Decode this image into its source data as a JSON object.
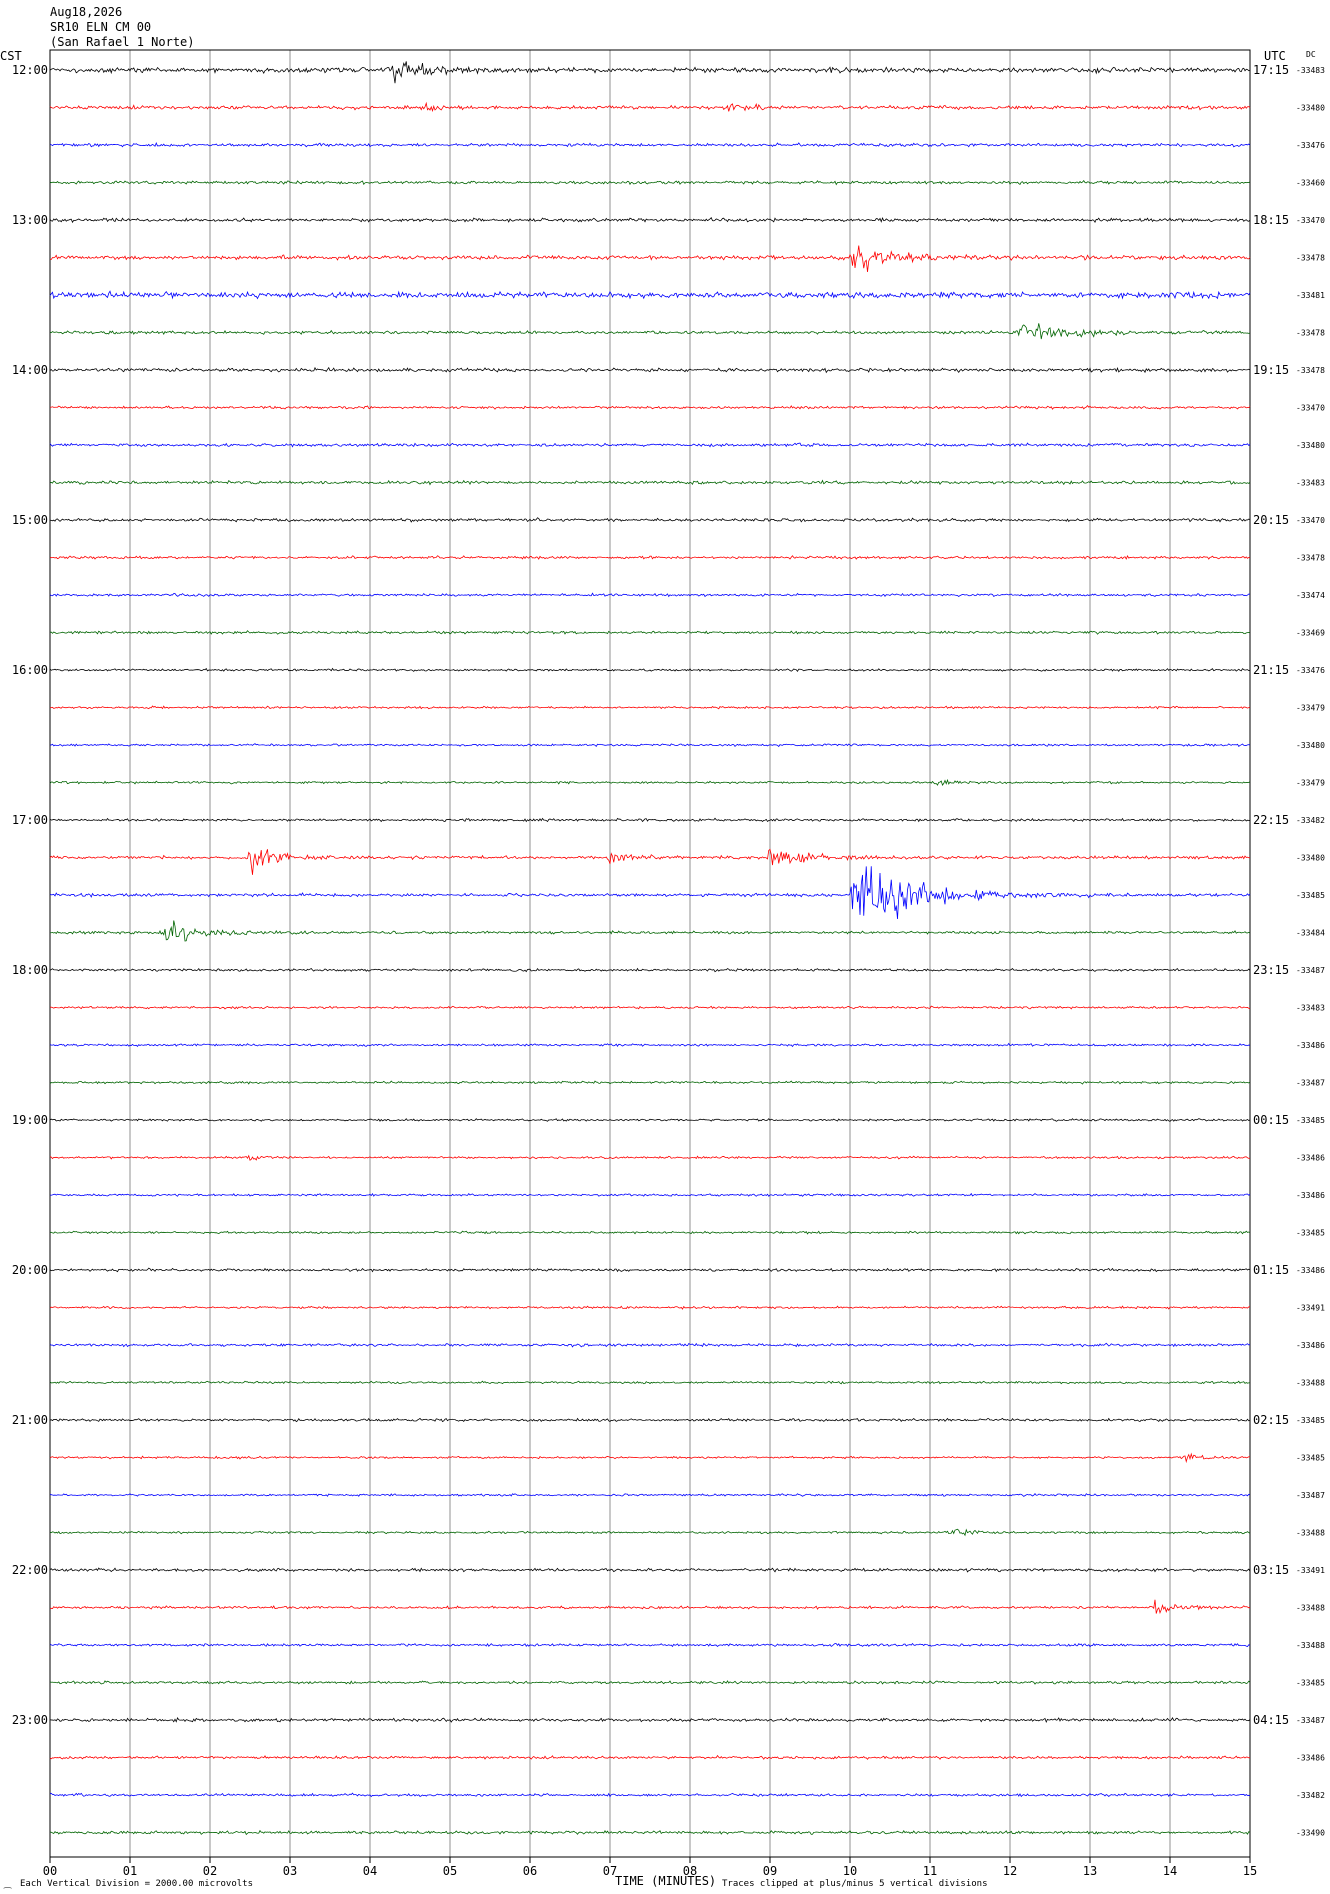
{
  "header": {
    "date": "Aug18,2026",
    "station": "SR10 ELN CM 00",
    "location": "(San Rafael 1 Norte)",
    "left_tz": "CST",
    "right_tz": "UTC",
    "dc_label": "DC"
  },
  "footer": {
    "scale_note": "Each Vertical Division = 2000.00 microvolts",
    "clip_note": "Traces clipped at plus/minus 5 vertical divisions"
  },
  "colors": {
    "black": "#000000",
    "red": "#ff0000",
    "blue": "#0000ff",
    "green": "#006400",
    "grid": "#909090"
  },
  "chart_data": {
    "type": "line",
    "title": "",
    "xlabel": "TIME (MINUTES)",
    "xlim": [
      0,
      15
    ],
    "x_ticks": [
      "00",
      "01",
      "02",
      "03",
      "04",
      "05",
      "06",
      "07",
      "08",
      "09",
      "10",
      "11",
      "12",
      "13",
      "14",
      "15"
    ],
    "trace_color_cycle": [
      "black",
      "red",
      "blue",
      "green"
    ],
    "hour_labels_cst": [
      "12:00",
      "13:00",
      "14:00",
      "15:00",
      "16:00",
      "17:00",
      "18:00",
      "19:00",
      "20:00",
      "21:00",
      "22:00",
      "23:00"
    ],
    "hour_labels_utc": [
      "17:15",
      "18:15",
      "19:15",
      "20:15",
      "21:15",
      "22:15",
      "23:15",
      "00:15",
      "01:15",
      "02:15",
      "03:15",
      "04:15"
    ],
    "dc_offsets": [
      "-33483",
      "-33480",
      "-33476",
      "-33460",
      "-33470",
      "-33478",
      "-33481",
      "-33478",
      "-33478",
      "-33470",
      "-33480",
      "-33483",
      "-33470",
      "-33478",
      "-33474",
      "-33469",
      "-33476",
      "-33479",
      "-33480",
      "-33479",
      "-33482",
      "-33480",
      "-33485",
      "-33484",
      "-33487",
      "-33483",
      "-33486",
      "-33487",
      "-33485",
      "-33486",
      "-33486",
      "-33485",
      "-33486",
      "-33491",
      "-33486",
      "-33488",
      "-33485",
      "-33485",
      "-33487",
      "-33488",
      "-33491",
      "-33488",
      "-33488",
      "-33485",
      "-33487",
      "-33486",
      "-33482",
      "-33490"
    ],
    "noise_amplitude": [
      2.2,
      1.6,
      1.4,
      1.4,
      1.6,
      1.8,
      2.6,
      1.4,
      1.6,
      1.2,
      1.4,
      1.4,
      1.4,
      1.2,
      1.2,
      1.2,
      1.0,
      1.0,
      1.0,
      1.0,
      1.2,
      1.4,
      1.4,
      1.2,
      1.2,
      1.0,
      1.0,
      1.0,
      1.0,
      1.0,
      1.0,
      1.0,
      1.2,
      1.0,
      1.2,
      1.0,
      1.2,
      1.0,
      1.0,
      1.0,
      1.4,
      1.2,
      1.2,
      1.2,
      1.4,
      1.2,
      1.2,
      1.4
    ],
    "events": [
      {
        "trace": 0,
        "minute": 4.25,
        "amplitude": 20,
        "duration": 0.7
      },
      {
        "trace": 1,
        "minute": 4.7,
        "amplitude": 5,
        "duration": 0.3
      },
      {
        "trace": 1,
        "minute": 8.5,
        "amplitude": 4,
        "duration": 0.4
      },
      {
        "trace": 5,
        "minute": 10.05,
        "amplitude": 14,
        "duration": 0.9
      },
      {
        "trace": 7,
        "minute": 12.1,
        "amplitude": 14,
        "duration": 1.1
      },
      {
        "trace": 19,
        "minute": 11.1,
        "amplitude": 5,
        "duration": 0.3
      },
      {
        "trace": 21,
        "minute": 2.5,
        "amplitude": 12,
        "duration": 0.7
      },
      {
        "trace": 21,
        "minute": 7.0,
        "amplitude": 7,
        "duration": 0.4
      },
      {
        "trace": 21,
        "minute": 9.0,
        "amplitude": 11,
        "duration": 0.8
      },
      {
        "trace": 22,
        "minute": 10.05,
        "amplitude": 42,
        "duration": 1.4
      },
      {
        "trace": 23,
        "minute": 1.45,
        "amplitude": 12,
        "duration": 0.9
      },
      {
        "trace": 29,
        "minute": 2.45,
        "amplitude": 4,
        "duration": 0.3
      },
      {
        "trace": 34,
        "minute": 7.9,
        "amplitude": 3,
        "duration": 0.3
      },
      {
        "trace": 37,
        "minute": 14.2,
        "amplitude": 4,
        "duration": 0.4
      },
      {
        "trace": 39,
        "minute": 11.3,
        "amplitude": 5,
        "duration": 0.4
      },
      {
        "trace": 41,
        "minute": 13.8,
        "amplitude": 6,
        "duration": 0.6
      }
    ]
  }
}
